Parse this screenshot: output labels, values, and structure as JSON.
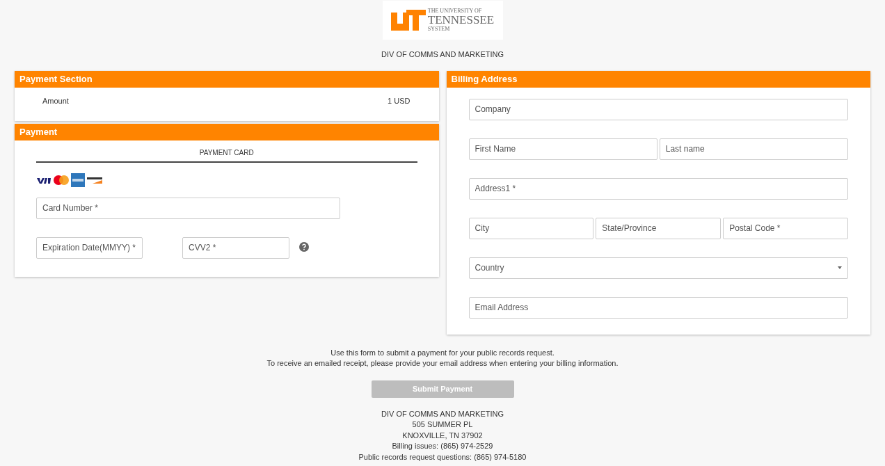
{
  "logo": {
    "line_1": "THE UNIVERSITY OF",
    "line_2": "TENNESSEE",
    "line_3": "SYSTEM"
  },
  "merchant": "DIV OF COMMS AND MARKETING",
  "payment_section": {
    "title": "Payment Section",
    "label": "Amount",
    "value": "1 USD"
  },
  "payment": {
    "title": "Payment",
    "tab": "PAYMENT CARD",
    "card_number": {
      "placeholder": "Card Number *"
    },
    "expiration": {
      "placeholder": "Expiration Date(MMYY) *"
    },
    "cvv": {
      "placeholder": "CVV2 *"
    }
  },
  "billing": {
    "title": "Billing Address",
    "rows": [
      [
        {
          "kind": "text",
          "placeholder": "Company"
        }
      ],
      [
        {
          "kind": "text",
          "placeholder": "First Name"
        },
        {
          "kind": "text",
          "placeholder": "Last name"
        }
      ],
      [
        {
          "kind": "text",
          "placeholder": "Address1 *"
        }
      ],
      [
        {
          "kind": "text",
          "placeholder": "City"
        },
        {
          "kind": "text",
          "placeholder": "State/Province"
        },
        {
          "kind": "text",
          "placeholder": "Postal Code *"
        }
      ],
      [
        {
          "kind": "select",
          "placeholder": "Country"
        }
      ],
      [
        {
          "kind": "text",
          "placeholder": "Email Address"
        }
      ]
    ]
  },
  "notes": [
    "Use this form to submit a payment for your public records request.",
    "To receive an emailed receipt, please provide your email address when entering your billing information."
  ],
  "submit": {
    "label": "Submit Payment",
    "disabled": true
  },
  "footer": [
    "DIV OF COMMS AND MARKETING",
    "505 SUMMER PL",
    "KNOXVILLE, TN 37902",
    "Billing issues: (865) 974-2529",
    "Public records request questions: (865) 974-5180"
  ]
}
